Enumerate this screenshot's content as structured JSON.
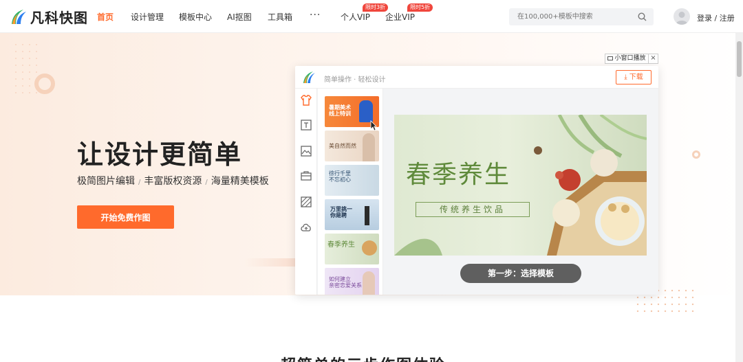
{
  "header": {
    "logo_text": "凡科快图",
    "nav": [
      {
        "label": "首页",
        "active": true
      },
      {
        "label": "设计管理"
      },
      {
        "label": "模板中心"
      },
      {
        "label": "AI抠图"
      },
      {
        "label": "工具箱"
      },
      {
        "label": "···"
      },
      {
        "label": "个人VIP",
        "badge": "限时3折"
      },
      {
        "label": "企业VIP",
        "badge": "限时5折"
      }
    ],
    "search_placeholder": "在100,000+模板中搜索",
    "login_label": "登录 / 注册"
  },
  "hero": {
    "title": "让设计更简单",
    "features": [
      "极简图片编辑",
      "丰富版权资源",
      "海量精美模板"
    ],
    "separator": "/",
    "cta_label": "开始免费作图"
  },
  "mini_window": {
    "label": "小窗口播放",
    "close": "×"
  },
  "demo": {
    "title": "简单操作 · 轻松设计",
    "download_label": "下载",
    "tools": [
      "tshirt-icon",
      "text-icon",
      "image-icon",
      "briefcase-icon",
      "texture-icon",
      "cloud-upload-icon"
    ],
    "thumbs": [
      {
        "text": "暑期美术\n线上特训"
      },
      {
        "text": "美自然而然"
      },
      {
        "text": "徐行千里\n不忘初心"
      },
      {
        "text": "万里挑一\n你是聘"
      },
      {
        "text": "春季养生"
      },
      {
        "text": "如何建立\n亲密恋爱关系"
      }
    ],
    "poster_title": "春季养生",
    "poster_subtitle": "传统养生饮品",
    "step_label": "第一步：选择模板"
  },
  "section": {
    "title": "超简单的三步作图体验"
  },
  "colors": {
    "accent": "#ff6a2c",
    "badge": "#f0463c",
    "poster_green": "#5f8a3b",
    "step_pill": "#5f5f5f"
  }
}
